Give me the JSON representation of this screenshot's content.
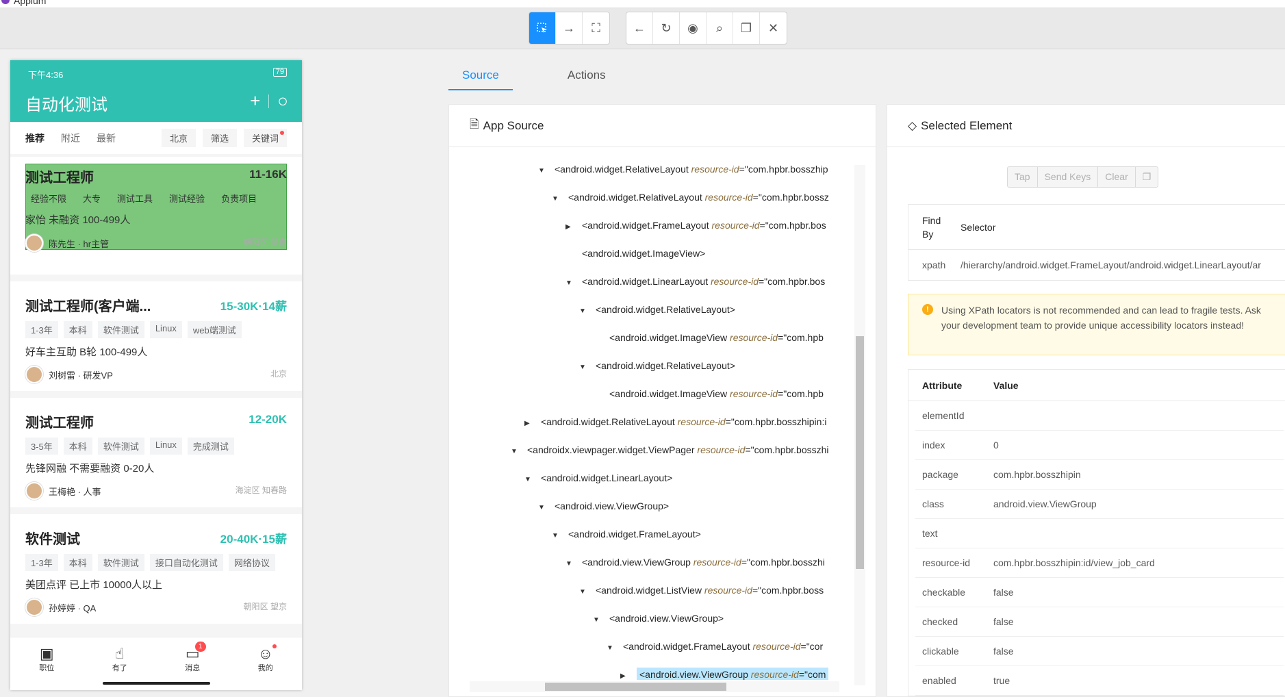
{
  "window": {
    "title": "Appium"
  },
  "toolbar": {
    "group1": [
      {
        "name": "select-elements-icon",
        "glyph": "⬚"
      },
      {
        "name": "swipe-icon",
        "glyph": "→"
      },
      {
        "name": "tap-coordinates-icon",
        "glyph": "⛶"
      }
    ],
    "group2": [
      {
        "name": "back-icon",
        "glyph": "←"
      },
      {
        "name": "refresh-icon",
        "glyph": "↻"
      },
      {
        "name": "eye-icon",
        "glyph": "◉"
      },
      {
        "name": "search-icon",
        "glyph": "⌕"
      },
      {
        "name": "copy-icon",
        "glyph": "❐"
      },
      {
        "name": "close-icon",
        "glyph": "✕"
      }
    ]
  },
  "phone": {
    "status_time": "下午4:36",
    "battery": "79",
    "app_title": "自动化测试",
    "filters": {
      "tabs": [
        "推荐",
        "附近",
        "最新"
      ],
      "chips": [
        "北京",
        "筛选",
        "关键词"
      ]
    },
    "jobs": [
      {
        "title": "测试工程师",
        "salary": "11-16K",
        "tags": [
          "经验不限",
          "大专",
          "测试工具",
          "测试经验",
          "负责项目"
        ],
        "company": "家怡 未融资 100-499人",
        "recruiter": "陈先生 · hr主管",
        "location": "朝阳区  望京"
      },
      {
        "title": "测试工程师(客户端...",
        "salary": "15-30K·14薪",
        "tags": [
          "1-3年",
          "本科",
          "软件测试",
          "Linux",
          "web端测试"
        ],
        "company": "好车主互助 B轮 100-499人",
        "recruiter": "刘树雷 · 研发VP",
        "location": "北京"
      },
      {
        "title": "测试工程师",
        "salary": "12-20K",
        "tags": [
          "3-5年",
          "本科",
          "软件测试",
          "Linux",
          "完成测试"
        ],
        "company": "先锋网融 不需要融资 0-20人",
        "recruiter": "王梅艳 · 人事",
        "location": "海淀区  知春路"
      },
      {
        "title": "软件测试",
        "salary": "20-40K·15薪",
        "tags": [
          "1-3年",
          "本科",
          "软件测试",
          "接口自动化测试",
          "网络协议"
        ],
        "company": "美团点评 已上市 10000人以上",
        "recruiter": "孙婷婷 · QA",
        "location": "朝阳区  望京"
      }
    ],
    "nav": [
      {
        "label": "职位",
        "icon": "briefcase-icon",
        "glyph": "💼"
      },
      {
        "label": "有了",
        "icon": "hand-icon",
        "glyph": "✋"
      },
      {
        "label": "消息",
        "icon": "message-icon",
        "glyph": "💬",
        "badge": "1"
      },
      {
        "label": "我的",
        "icon": "user-icon",
        "glyph": "👤"
      }
    ]
  },
  "tabs": {
    "source": "Source",
    "actions": "Actions"
  },
  "source_panel": {
    "title": "App Source",
    "rows": [
      {
        "arrow": "▼",
        "tag": "<android.widget.RelativeLayout ",
        "attr": "resource-id",
        "val": "=\"com.hpbr.bosszhip"
      },
      {
        "arrow": "▼",
        "tag": "<android.widget.RelativeLayout ",
        "attr": "resource-id",
        "val": "=\"com.hpbr.bossz"
      },
      {
        "arrow": "▶",
        "tag": "<android.widget.FrameLayout ",
        "attr": "resource-id",
        "val": "=\"com.hpbr.bos"
      },
      {
        "arrow": "",
        "tag": "<android.widget.ImageView>",
        "attr": "",
        "val": ""
      },
      {
        "arrow": "▼",
        "tag": "<android.widget.LinearLayout ",
        "attr": "resource-id",
        "val": "=\"com.hpbr.bos"
      },
      {
        "arrow": "▼",
        "tag": "<android.widget.RelativeLayout>",
        "attr": "",
        "val": ""
      },
      {
        "arrow": "",
        "tag": "<android.widget.ImageView ",
        "attr": "resource-id",
        "val": "=\"com.hpb"
      },
      {
        "arrow": "▼",
        "tag": "<android.widget.RelativeLayout>",
        "attr": "",
        "val": ""
      },
      {
        "arrow": "",
        "tag": "<android.widget.ImageView ",
        "attr": "resource-id",
        "val": "=\"com.hpb"
      },
      {
        "arrow": "▶",
        "tag": "<android.widget.RelativeLayout ",
        "attr": "resource-id",
        "val": "=\"com.hpbr.bosszhipin:i"
      },
      {
        "arrow": "▼",
        "tag": "<androidx.viewpager.widget.ViewPager ",
        "attr": "resource-id",
        "val": "=\"com.hpbr.bosszhi"
      },
      {
        "arrow": "▼",
        "tag": "<android.widget.LinearLayout>",
        "attr": "",
        "val": ""
      },
      {
        "arrow": "▼",
        "tag": "<android.view.ViewGroup>",
        "attr": "",
        "val": ""
      },
      {
        "arrow": "▼",
        "tag": "<android.widget.FrameLayout>",
        "attr": "",
        "val": ""
      },
      {
        "arrow": "▼",
        "tag": "<android.view.ViewGroup ",
        "attr": "resource-id",
        "val": "=\"com.hpbr.bosszhi"
      },
      {
        "arrow": "▼",
        "tag": "<android.widget.ListView ",
        "attr": "resource-id",
        "val": "=\"com.hpbr.boss"
      },
      {
        "arrow": "▼",
        "tag": "<android.view.ViewGroup>",
        "attr": "",
        "val": ""
      },
      {
        "arrow": "▼",
        "tag": "<android.widget.FrameLayout ",
        "attr": "resource-id",
        "val": "=\"cor"
      },
      {
        "arrow": "▶",
        "tag": "<android.view.ViewGroup ",
        "attr": "resource-id",
        "val": "=\"com",
        "selected": true
      }
    ]
  },
  "selected_panel": {
    "title": "Selected Element",
    "actions": [
      "Tap",
      "Send Keys",
      "Clear"
    ],
    "selector_head": {
      "find_by": "Find By",
      "selector": "Selector"
    },
    "selector_row": {
      "find_by": "xpath",
      "selector": "/hierarchy/android.widget.FrameLayout/android.widget.LinearLayout/ar"
    },
    "warning": "Using XPath locators is not recommended and can lead to fragile tests. Ask your development team to provide unique accessibility locators instead!",
    "attr_head": {
      "attribute": "Attribute",
      "value": "Value"
    },
    "attributes": [
      {
        "k": "elementId",
        "v": ""
      },
      {
        "k": "index",
        "v": "0"
      },
      {
        "k": "package",
        "v": "com.hpbr.bosszhipin"
      },
      {
        "k": "class",
        "v": "android.view.ViewGroup"
      },
      {
        "k": "text",
        "v": ""
      },
      {
        "k": "resource-id",
        "v": "com.hpbr.bosszhipin:id/view_job_card"
      },
      {
        "k": "checkable",
        "v": "false"
      },
      {
        "k": "checked",
        "v": "false"
      },
      {
        "k": "clickable",
        "v": "false"
      },
      {
        "k": "enabled",
        "v": "true"
      }
    ]
  }
}
